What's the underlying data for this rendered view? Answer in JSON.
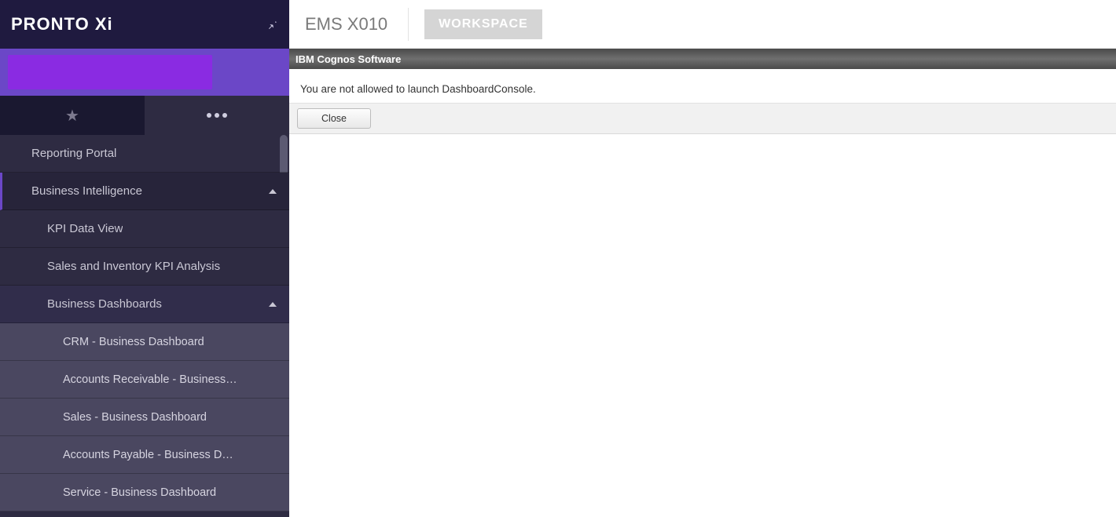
{
  "brand": {
    "name": "PRONTO Xi"
  },
  "sidebar": {
    "items": [
      {
        "label": "Reporting Portal"
      },
      {
        "label": "Business Intelligence",
        "expanded": true
      },
      {
        "label": "KPI Data View"
      },
      {
        "label": "Sales and Inventory KPI Analysis"
      },
      {
        "label": "Business Dashboards",
        "expanded": true
      },
      {
        "label": "CRM - Business Dashboard"
      },
      {
        "label": "Accounts Receivable - Business…"
      },
      {
        "label": "Sales - Business Dashboard"
      },
      {
        "label": "Accounts Payable - Business D…"
      },
      {
        "label": "Service - Business Dashboard"
      }
    ]
  },
  "header": {
    "app_title": "EMS X010",
    "workspace_button": "WORKSPACE"
  },
  "cognos": {
    "title": "IBM Cognos Software",
    "message": "You are not allowed to launch DashboardConsole.",
    "close_label": "Close"
  }
}
